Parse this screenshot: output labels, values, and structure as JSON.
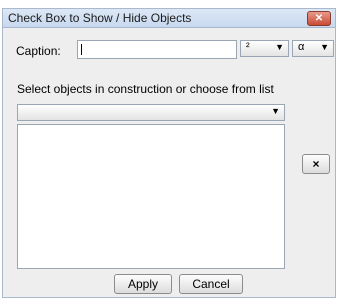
{
  "window": {
    "title": "Check Box to Show / Hide Objects",
    "close_label": "✕"
  },
  "caption": {
    "label": "Caption:",
    "value": ""
  },
  "format_dropdown": {
    "value": "²",
    "arrow": "▼"
  },
  "symbol_dropdown": {
    "value": "α",
    "arrow": "▼"
  },
  "objects": {
    "label": "Select objects in construction or choose from list",
    "dropdown_value": "",
    "dropdown_arrow": "▼",
    "list_items": []
  },
  "remove_button": {
    "label": "×"
  },
  "buttons": {
    "apply": "Apply",
    "cancel": "Cancel"
  }
}
